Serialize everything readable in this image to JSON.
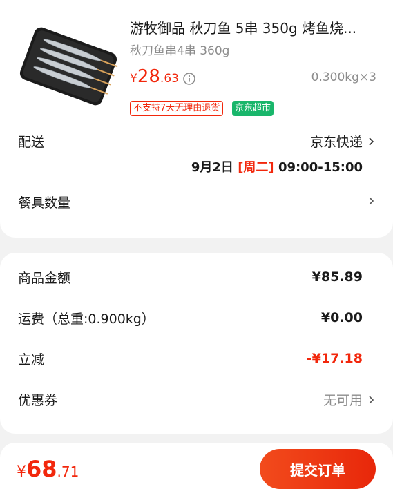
{
  "product": {
    "title": "游牧御品 秋刀鱼 5串 350g 烤鱼烧...",
    "spec": "秋刀鱼串4串 360g",
    "price_symbol": "¥",
    "price_int": "28",
    "price_dec": ".63",
    "qty": "0.300kg×3",
    "tag_return": "不支持7天无理由退货",
    "tag_supermarket": "京东超市",
    "image_icon": "grilled-saury-skewers-image"
  },
  "delivery": {
    "label": "配送",
    "carrier": "京东快递",
    "date": "9月2日",
    "weekday": "[周二]",
    "time": "09:00-15:00"
  },
  "tableware": {
    "label": "餐具数量"
  },
  "summary": {
    "goods_label": "商品金额",
    "goods_value": "¥85.89",
    "freight_label": "运费（总重:0.900kg）",
    "freight_value": "¥0.00",
    "discount_label": "立减",
    "discount_value": "-¥17.18",
    "coupon_label": "优惠券",
    "coupon_value": "无可用"
  },
  "footer": {
    "total_symbol": "¥",
    "total_int": "68",
    "total_dec": ".71",
    "submit_label": "提交订单"
  },
  "colors": {
    "accent_red": "#f2270c",
    "supermarket_green": "#19b66b",
    "muted_gray": "#8c8c8c"
  }
}
